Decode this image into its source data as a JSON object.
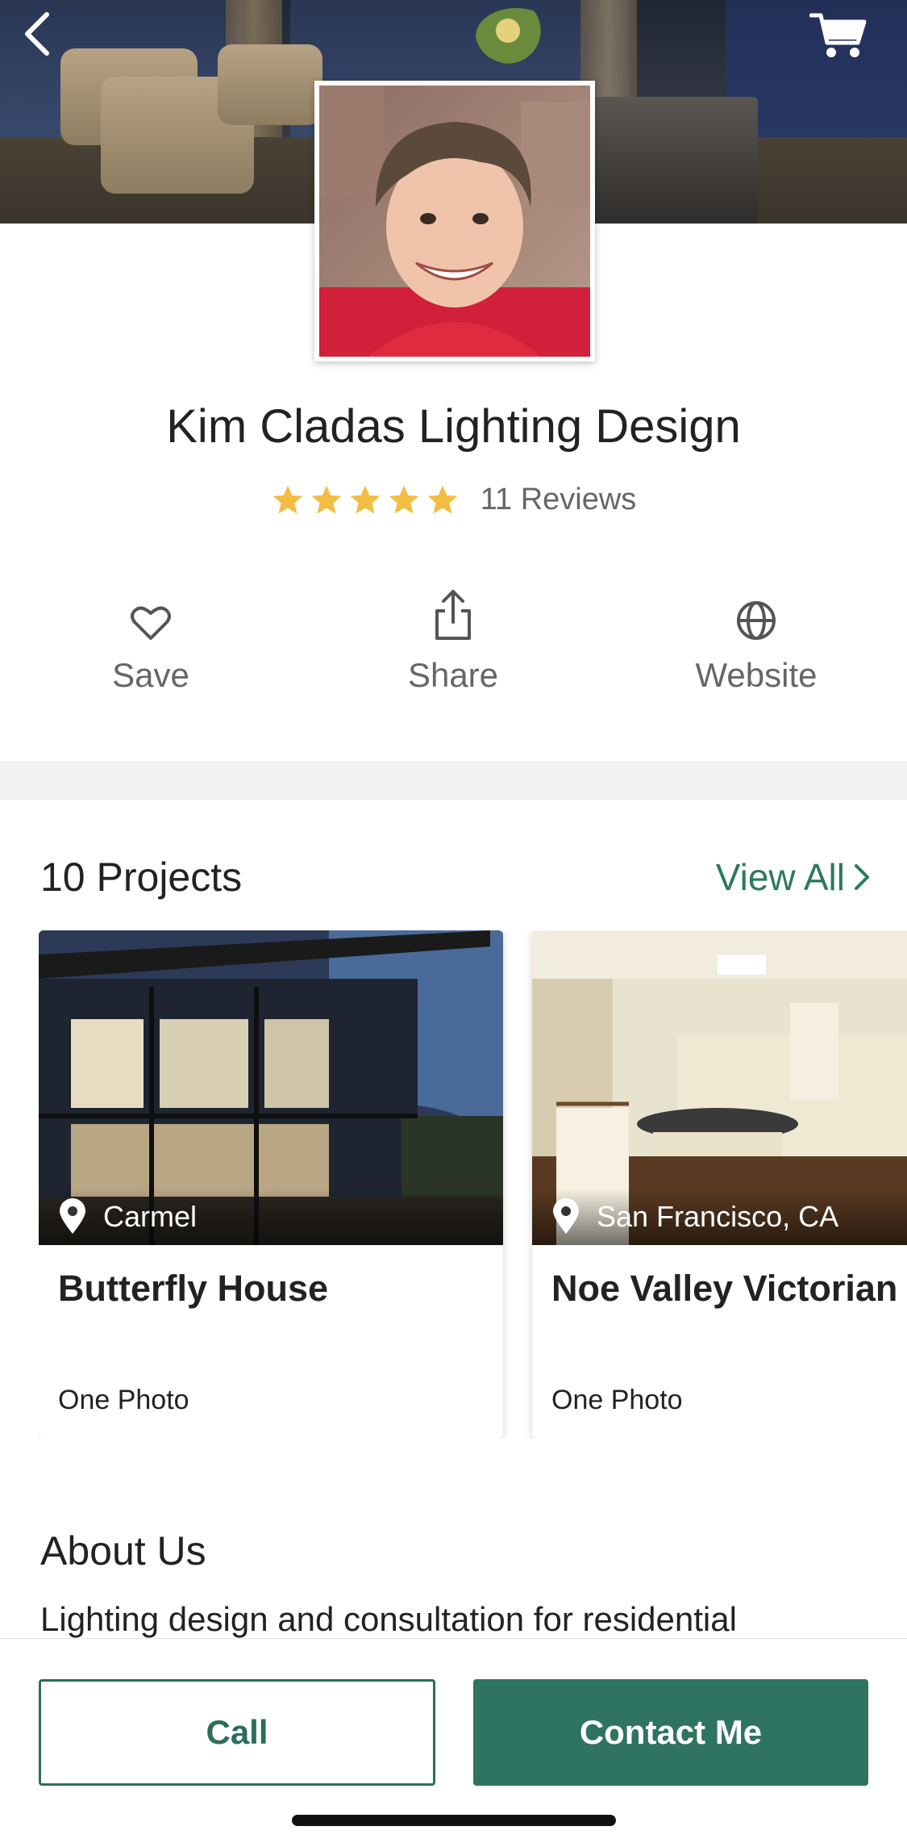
{
  "header": {
    "back_icon": "chevron-left-icon",
    "cart_icon": "shopping-cart-icon"
  },
  "profile": {
    "business_name": "Kim Cladas Lighting Design",
    "rating_stars": 5,
    "reviews_label": "11 Reviews",
    "star_color": "#f3bd42"
  },
  "actions": [
    {
      "label": "Save",
      "icon": "heart-icon"
    },
    {
      "label": "Share",
      "icon": "share-icon"
    },
    {
      "label": "Website",
      "icon": "globe-icon"
    }
  ],
  "projects": {
    "title": "10 Projects",
    "view_all_label": "View All",
    "items": [
      {
        "location": "Carmel",
        "title": "Butterfly House",
        "photo_count": "One Photo"
      },
      {
        "location": "San Francisco, CA",
        "title": "Noe Valley Victorian",
        "photo_count": "One Photo"
      }
    ]
  },
  "about": {
    "title": "About Us",
    "text": "Lighting design and consultation for residential"
  },
  "footer": {
    "call_label": "Call",
    "contact_label": "Contact Me"
  },
  "colors": {
    "accent": "#2c7a5c",
    "button_fill": "#2f7361"
  }
}
